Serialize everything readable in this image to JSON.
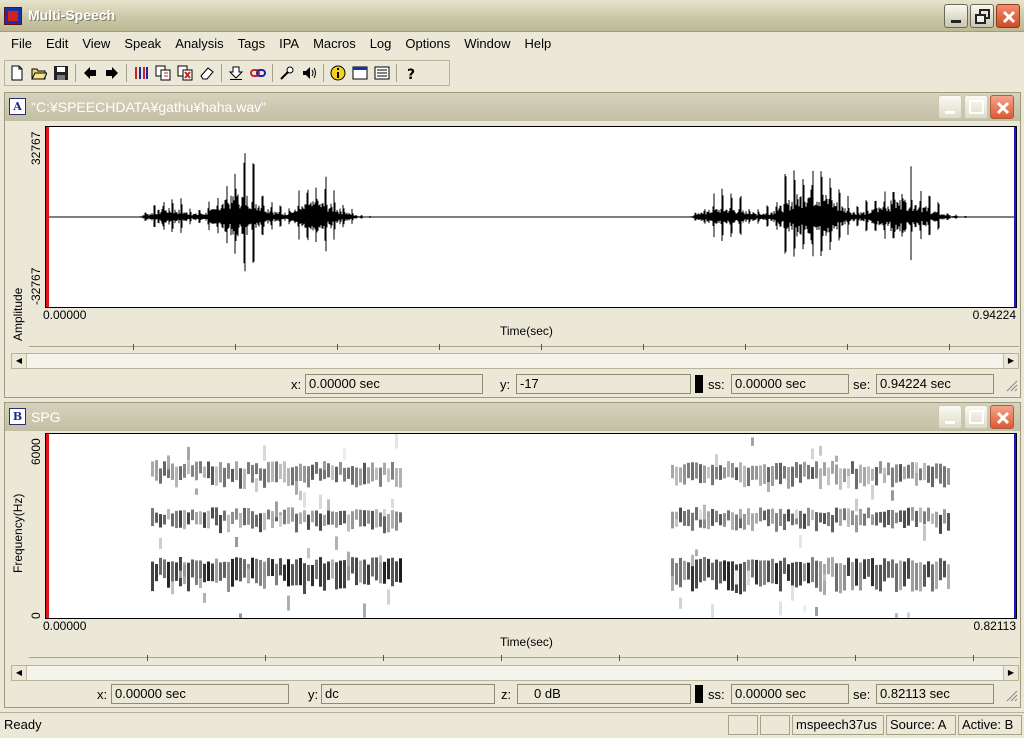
{
  "app": {
    "title": "Multi-Speech"
  },
  "menu": [
    "File",
    "Edit",
    "View",
    "Speak",
    "Analysis",
    "Tags",
    "IPA",
    "Macros",
    "Log",
    "Options",
    "Window",
    "Help"
  ],
  "toolbar": {
    "icons": [
      "new-file-icon",
      "open-folder-icon",
      "save-icon",
      "back-arrow-icon",
      "forward-arrow-icon",
      "waveform-bars-icon",
      "copy-pages-icon",
      "delete-pages-icon",
      "eraser-icon",
      "record-down-icon",
      "link-icon",
      "microphone-icon",
      "speaker-icon",
      "info-icon",
      "window-icon",
      "list-icon",
      "help-icon"
    ]
  },
  "panel_a": {
    "letter": "A",
    "title": "\"C:¥SPEECHDATA¥gathu¥haha.wav\"",
    "ylabel": "Amplitude",
    "ymax": "32767",
    "ymin": "-32767",
    "xstart": "0.00000",
    "xend": "0.94224",
    "xlabel": "Time(sec)",
    "status": {
      "x_label": "x:",
      "x_value": "0.00000 sec",
      "y_label": "y:",
      "y_value": "-17",
      "ss_label": "ss:",
      "ss_value": "0.00000 sec",
      "se_label": "se:",
      "se_value": "0.94224 sec"
    }
  },
  "panel_b": {
    "letter": "B",
    "title": "SPG",
    "ylabel": "Frequency(Hz)",
    "ymax": "6000",
    "ymin": "0",
    "xstart": "0.00000",
    "xend": "0.82113",
    "xlabel": "Time(sec)",
    "status": {
      "x_label": "x:",
      "x_value": "0.00000 sec",
      "y_label": "y:",
      "y_value": "dc",
      "z_label": "z:",
      "z_value": "0 dB",
      "ss_label": "ss:",
      "ss_value": "0.00000 sec",
      "se_label": "se:",
      "se_value": "0.82113 sec"
    }
  },
  "statusbar": {
    "ready": "Ready",
    "cells": [
      "",
      "",
      "mspeech37us",
      "Source: A",
      "Active: B"
    ]
  }
}
